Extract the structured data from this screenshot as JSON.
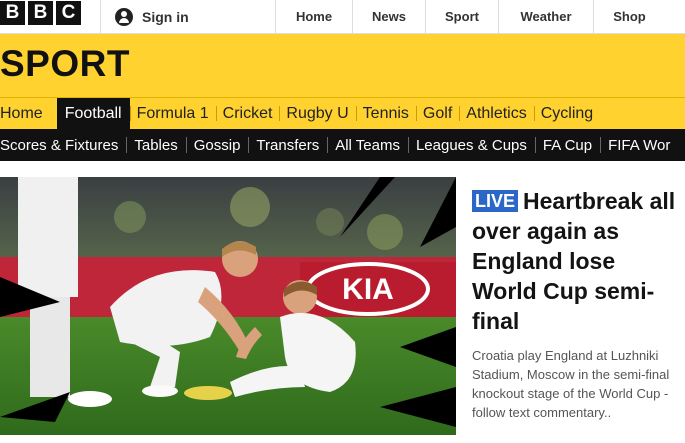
{
  "global_header": {
    "logo_letters": [
      "B",
      "B",
      "C"
    ],
    "signin_label": "Sign in",
    "nav": [
      "Home",
      "News",
      "Sport",
      "Weather",
      "Shop"
    ]
  },
  "sport_header": {
    "title": "SPORT",
    "bg_color": "#ffd230"
  },
  "primary_nav": {
    "items": [
      "Home",
      "Football",
      "Formula 1",
      "Cricket",
      "Rugby U",
      "Tennis",
      "Golf",
      "Athletics",
      "Cycling"
    ],
    "active": "Football"
  },
  "secondary_nav": {
    "items": [
      "Scores & Fixtures",
      "Tables",
      "Gossip",
      "Transfers",
      "All Teams",
      "Leagues & Cups",
      "FA Cup",
      "FIFA Wor"
    ]
  },
  "article": {
    "live_badge": "LIVE",
    "headline": "Heartbreak all over again as England lose World Cup semi-final",
    "summary": "Croatia play England at Luzhniki Stadium, Moscow in the semi-final knockout stage of the World Cup - follow text commentary..",
    "live_color": "#2b66c9"
  },
  "hero_image": {
    "banner_text": "KIA"
  }
}
